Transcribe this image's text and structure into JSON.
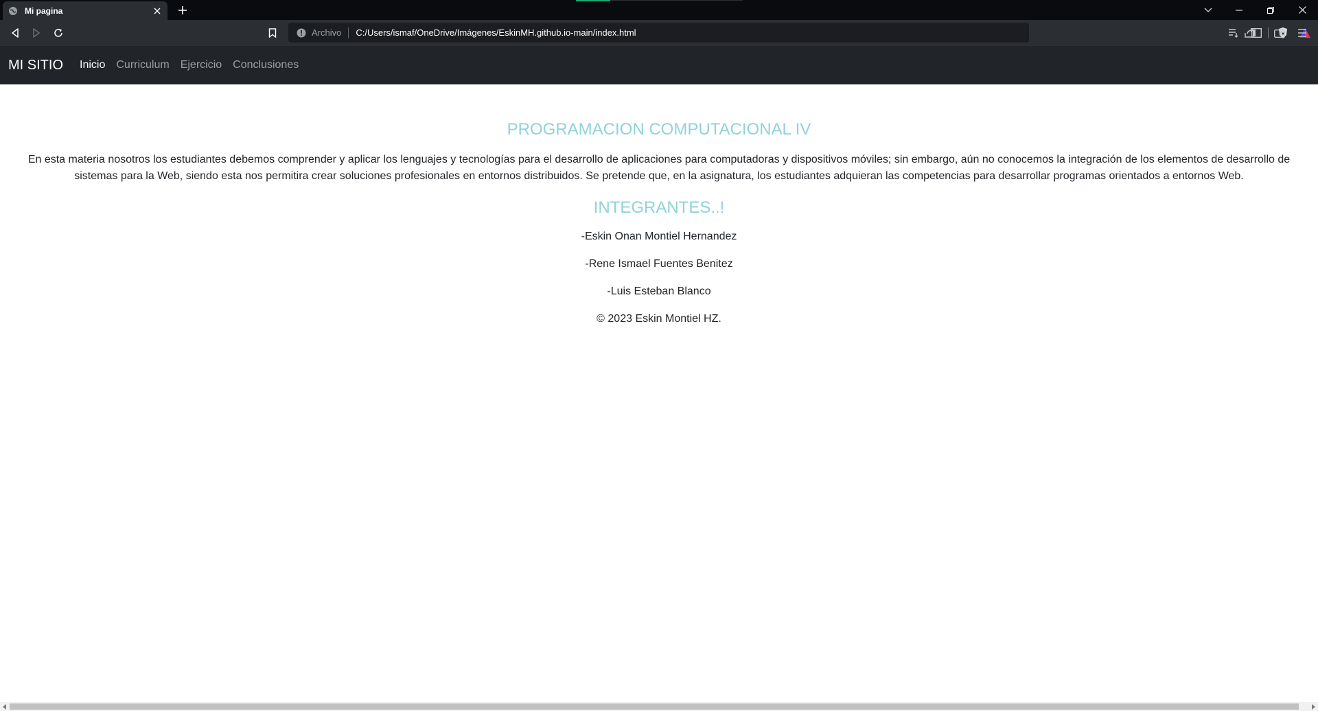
{
  "browser": {
    "tab_title": "Mi pagina",
    "url_scheme": "Archivo",
    "url": "C:/Users/ismaf/OneDrive/Imágenes/EskinMH.github.io-main/index.html",
    "icons": [
      "globe-icon",
      "close-icon",
      "plus-icon",
      "back-icon",
      "forward-icon",
      "reload-icon",
      "bookmark-icon",
      "info-icon",
      "share-icon",
      "brave-shield-icon",
      "brave-rewards-icon",
      "playlist-icon",
      "sidebar-icon",
      "wallet-icon",
      "menu-icon",
      "chevron-down-icon",
      "minimize-icon",
      "restore-icon"
    ]
  },
  "navbar": {
    "brand": "MI SITIO",
    "links": [
      "Inicio",
      "Curriculum",
      "Ejercicio",
      "Conclusiones"
    ],
    "active": "Inicio"
  },
  "content": {
    "title": "PROGRAMACION COMPUTACIONAL IV",
    "description": "En esta materia nosotros los estudiantes debemos comprender y aplicar los lenguajes y tecnologías para el desarrollo de aplicaciones para computadoras y dispositivos móviles; sin embargo, aún no conocemos la integración de los elementos de desarrollo de sistemas para la Web, siendo esta nos permitira crear soluciones profesionales en entornos distribuidos. Se pretende que, en la asignatura, los estudiantes adquieran las competencias para desarrollar programas orientados a entornos Web.",
    "members_title": "INTEGRANTES..!",
    "members": [
      "-Eskin Onan Montiel Hernandez",
      "-Rene Ismael Fuentes Benitez",
      "-Luis Esteban Blanco"
    ],
    "footer": "© 2023 Eskin Montiel HZ."
  },
  "colors": {
    "navbar_bg": "#212529",
    "heading": "#8fd3d9",
    "chrome_bg": "#2b2e33"
  }
}
